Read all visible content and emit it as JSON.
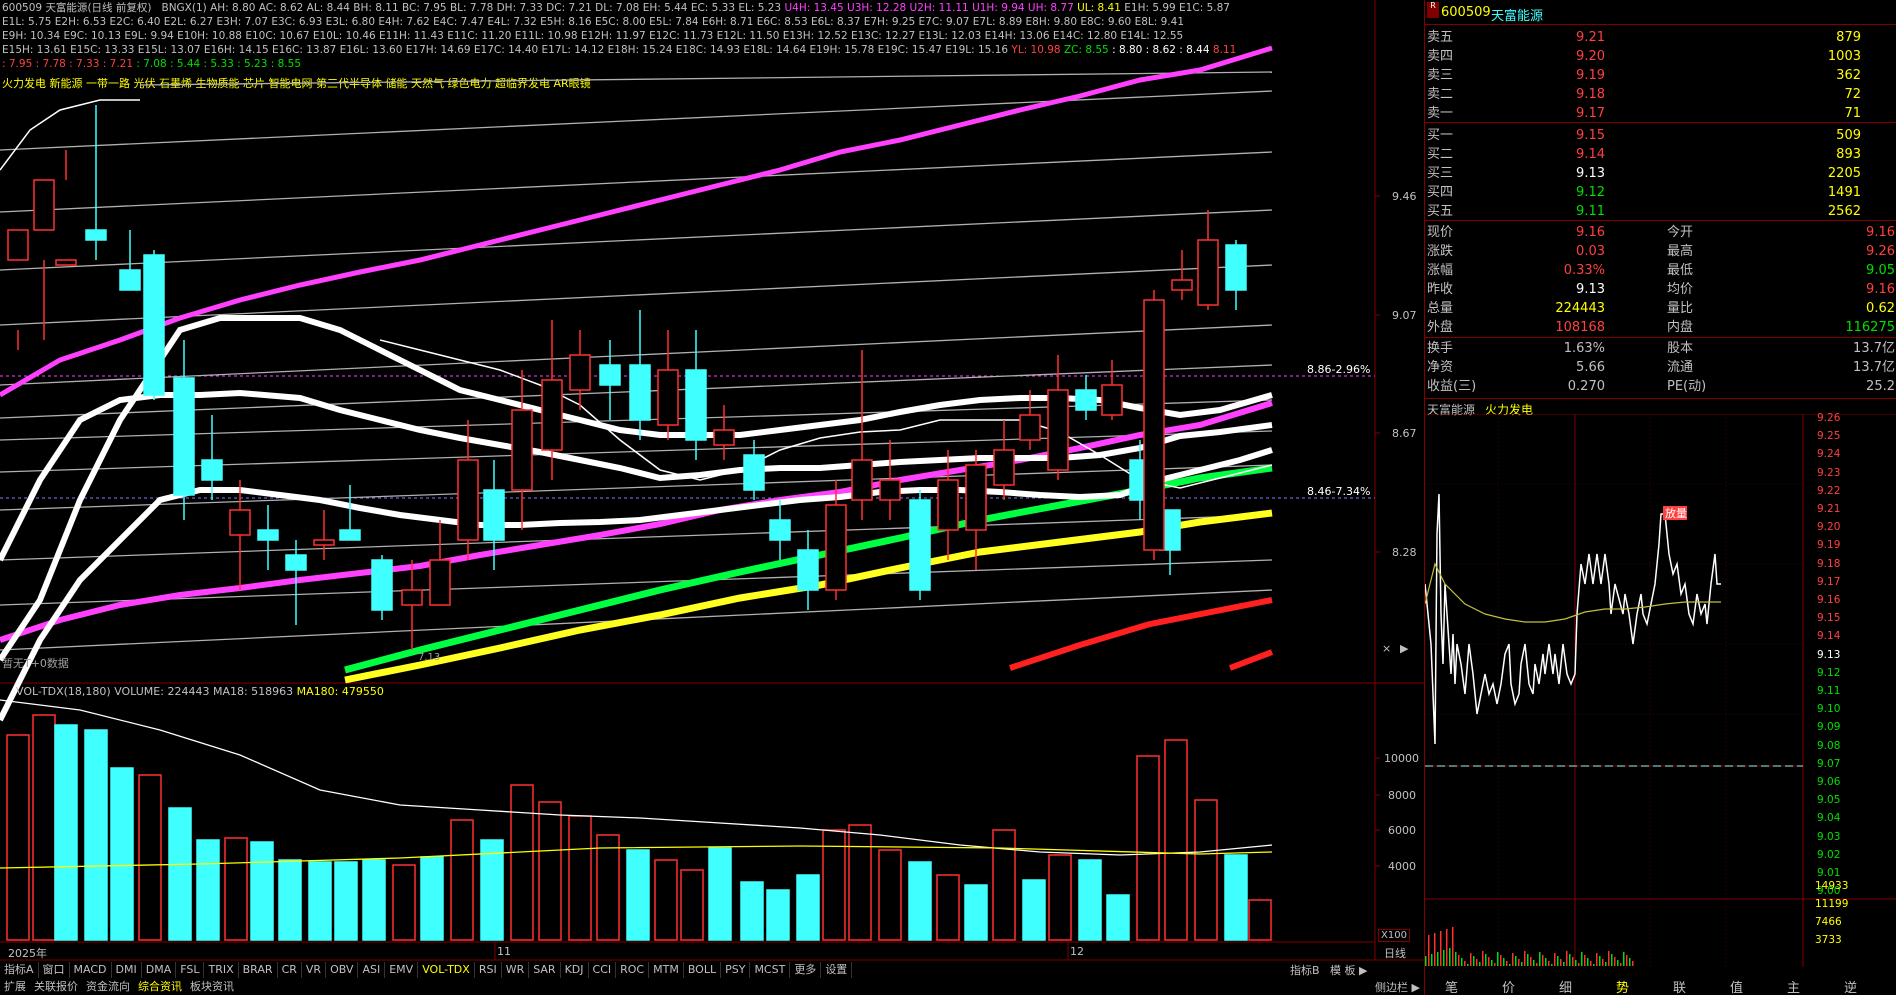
{
  "header": {
    "title_code": "600509",
    "title_name": "天富能源",
    "title_mode": "(日线 前复权)",
    "indicator": "BNGX(1)",
    "line1": [
      "AH: 8.80",
      "AC: 8.62",
      "AL: 8.44",
      "BH: 8.11",
      "BC: 7.95",
      "BL: 7.78",
      "DH: 7.33",
      "DC: 7.21",
      "DL: 7.08",
      "EH: 5.44",
      "EC: 5.33",
      "EL: 5.23"
    ],
    "line1_mag": [
      "U4H: 13.45",
      "U3H: 12.28",
      "U2H: 11.11",
      "U1H: 9.94",
      "UH: 8.77"
    ],
    "line1_yel": "UL: 8.41",
    "line1_tail": [
      "E1H: 5.99",
      "E1C: 5.87"
    ],
    "line2": "E1L: 5.75  E2H: 6.53  E2C: 6.40  E2L: 6.27  E3H: 7.07  E3C: 6.93  E3L: 6.80  E4H: 7.62  E4C: 7.47  E4L: 7.32  E5H: 8.16  E5C: 8.00  E5L: 7.84  E6H: 8.71  E6C: 8.53  E6L: 8.37  E7H: 9.25  E7C: 9.07  E7L: 8.89  E8H: 9.80  E8C: 9.60  E8L: 9.41",
    "line3": "E9H: 10.34  E9C: 10.13  E9L: 9.94  E10H: 10.88  E10C: 10.67  E10L: 10.46  E11H: 11.43  E11C: 11.20  E11L: 10.98  E12H: 11.97  E12C: 11.73  E12L: 11.50  E13H: 12.52  E13C: 12.27  E13L: 12.03  E14H: 13.06  E14C: 12.80  E14L: 12.55",
    "line4": "E15H: 13.61  E15C: 13.33  E15L: 13.07  E16H: 14.15  E16C: 13.87  E16L: 13.60  E17H: 14.69  E17C: 14.40  E17L: 14.12  E18H: 15.24  E18C: 14.93  E18L: 14.64  E19H: 15.78  E19C: 15.47  E19L: 15.16",
    "line4_yl": "YL: 10.98",
    "line4_zc": "ZC: 8.55",
    "line4_tail": ": 8.80  : 8.62  : 8.44",
    "line4_red": "8.11",
    "line5_red": ": 7.95  : 7.78  : 7.33  : 7.21",
    "line5_grn": ": 7.08  : 5.44  : 5.33  : 5.23  : 8.55",
    "concepts": "火力发电 新能源 一带一路 光伏 石墨烯 生物质能 芯片 智能电网 第三代半导体 储能 天然气 绿色电力 超临界发电 AR眼镜",
    "no_data": "暂无T+0数据"
  },
  "price_axis": [
    "9.46",
    "9.07",
    "8.67",
    "8.28"
  ],
  "markers": {
    "m1": "8.86-2.96%",
    "m2": "8.46-7.34%",
    "low": "7.13"
  },
  "volume": {
    "title": "VOL-TDX(18,180)",
    "vol": "VOLUME: 224443",
    "ma18": "MA18: 518963",
    "ma180": "MA180: 479550",
    "axis": [
      "10000",
      "8000",
      "6000",
      "4000"
    ],
    "unit": "X100"
  },
  "date_axis": {
    "d1": "2025年",
    "d2": "11",
    "d3": "12",
    "period": "日线"
  },
  "bottom_tabs": [
    "指标A",
    "窗口",
    "MACD",
    "DMI",
    "DMA",
    "FSL",
    "TRIX",
    "BRAR",
    "CR",
    "VR",
    "OBV",
    "ASI",
    "EMV",
    "VOL-TDX",
    "RSI",
    "WR",
    "SAR",
    "KDJ",
    "CCI",
    "ROC",
    "MTM",
    "BOLL",
    "PSY",
    "MCST",
    "更多",
    "设置"
  ],
  "bottom_right_tabs": [
    "指标B",
    "模 板"
  ],
  "bottom_tabs2": [
    "扩展",
    "关联报价",
    "资金流向",
    "综合资讯",
    "板块资讯"
  ],
  "side_toggle": "侧边栏",
  "quote": {
    "code": "600509",
    "name": "天富能源",
    "asks": [
      {
        "label": "卖五",
        "price": "9.21",
        "vol": "879"
      },
      {
        "label": "卖四",
        "price": "9.20",
        "vol": "1003"
      },
      {
        "label": "卖三",
        "price": "9.19",
        "vol": "362"
      },
      {
        "label": "卖二",
        "price": "9.18",
        "vol": "72"
      },
      {
        "label": "卖一",
        "price": "9.17",
        "vol": "71"
      }
    ],
    "bids": [
      {
        "label": "买一",
        "price": "9.15",
        "vol": "509"
      },
      {
        "label": "买二",
        "price": "9.14",
        "vol": "893"
      },
      {
        "label": "买三",
        "price": "9.13",
        "vol": "2205"
      },
      {
        "label": "买四",
        "price": "9.12",
        "vol": "1491"
      },
      {
        "label": "买五",
        "price": "9.11",
        "vol": "2562"
      }
    ],
    "stats": [
      {
        "l": "现价",
        "v": "9.16",
        "l2": "今开",
        "v2": "9.16"
      },
      {
        "l": "涨跌",
        "v": "0.03",
        "l2": "最高",
        "v2": "9.26"
      },
      {
        "l": "涨幅",
        "v": "0.33%",
        "l2": "最低",
        "v2": "9.05"
      },
      {
        "l": "昨收",
        "v": "9.13",
        "l2": "均价",
        "v2": "9.16"
      },
      {
        "l": "总量",
        "v": "224443",
        "l2": "量比",
        "v2": "0.62"
      },
      {
        "l": "外盘",
        "v": "108168",
        "l2": "内盘",
        "v2": "116275"
      }
    ],
    "stats2": [
      {
        "l": "换手",
        "v": "1.63%",
        "l2": "股本",
        "v2": "13.7亿"
      },
      {
        "l": "净资",
        "v": "5.66",
        "l2": "流通",
        "v2": "13.7亿"
      },
      {
        "l": "收益(三)",
        "v": "0.270",
        "l2": "PE(动)",
        "v2": "25.2"
      }
    ],
    "intraday_name": "天富能源",
    "intraday_sector": "火力发电",
    "intraday_axis": [
      "9.26",
      "9.25",
      "9.24",
      "9.23",
      "9.22",
      "9.21",
      "9.20",
      "9.19",
      "9.18",
      "9.17",
      "9.16",
      "9.15",
      "9.14",
      "9.13",
      "9.12",
      "9.11",
      "9.10",
      "9.09",
      "9.08",
      "9.07",
      "9.06",
      "9.05",
      "9.04",
      "9.03",
      "9.02",
      "9.01",
      "9.00"
    ],
    "intraday_vol_axis": [
      "14933",
      "11199",
      "7466",
      "3733"
    ],
    "intraday_tag": "放量",
    "right_tabs": [
      "笔",
      "价",
      "细",
      "势",
      "联",
      "值",
      "主",
      "逆"
    ]
  },
  "colors": {
    "up": "#ff3030",
    "down": "#40ffff",
    "ma_white": "#ffffff",
    "ma_mag": "#ff40ff",
    "ma_grn": "#00ff40",
    "ma_yel": "#ffff20"
  }
}
